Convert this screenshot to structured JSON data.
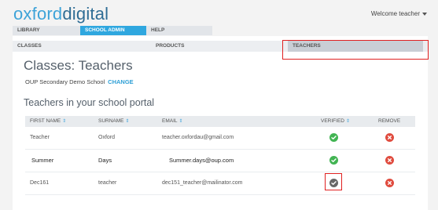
{
  "header": {
    "logo_part1": "oxford",
    "logo_part2": "digital",
    "welcome": "Welcome teacher"
  },
  "nav": {
    "items": [
      {
        "label": "LIBRARY"
      },
      {
        "label": "SCHOOL ADMIN"
      },
      {
        "label": "HELP"
      }
    ]
  },
  "subtabs": {
    "items": [
      {
        "label": "CLASSES"
      },
      {
        "label": "PRODUCTS"
      },
      {
        "label": "TEACHERS"
      }
    ]
  },
  "page": {
    "title": "Classes: Teachers",
    "school": "OUP Secondary Demo School",
    "change": "CHANGE",
    "section_title": "Teachers in your school portal"
  },
  "table": {
    "headers": [
      "FIRST NAME",
      "SURNAME",
      "EMAIL",
      "VERIFIED",
      "REMOVE"
    ],
    "sort_icon": "⇕",
    "rows": [
      {
        "first": "Teacher",
        "surname": "Oxford",
        "email": "teacher.oxfordau@gmail.com",
        "verified": true
      },
      {
        "first": "Summer",
        "surname": "Days",
        "email": "Summer.days@oup.com",
        "verified": true
      },
      {
        "first": "Dec161",
        "surname": "teacher",
        "email": "dec151_teacher@mailinator.com",
        "verified": false
      }
    ]
  },
  "colors": {
    "accent": "#2fa7df",
    "verified_green": "#42b453",
    "unverified_grey": "#666666",
    "remove_red": "#e04c3f",
    "highlight_red": "#e02020"
  },
  "icons": {
    "verified": "check-circle-icon",
    "remove": "x-circle-icon"
  }
}
